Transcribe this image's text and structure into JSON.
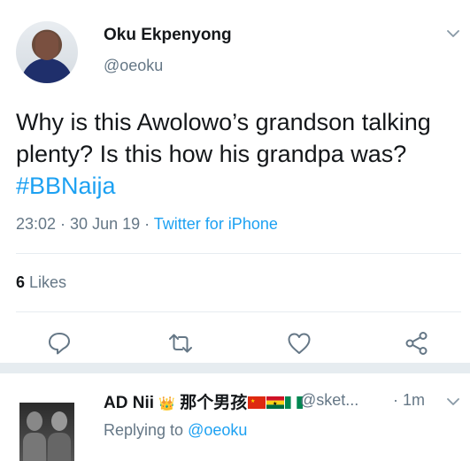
{
  "tweet": {
    "author_name": "Oku Ekpenyong",
    "author_handle": "@oeoku",
    "text_main": "Why is this Awolowo’s grandson talking plenty? Is this how his grandpa was? ",
    "hashtag": "#BBNaija",
    "time": "23:02",
    "dot1": " · ",
    "date": "30 Jun 19",
    "dot2": " · ",
    "source": "Twitter for iPhone",
    "likes_count": "6",
    "likes_label": " Likes"
  },
  "actions": {
    "icons": [
      "reply-icon",
      "retweet-icon",
      "like-icon",
      "share-icon"
    ]
  },
  "reply": {
    "author_name": "AD Nii",
    "crown": "👑",
    "name_chinese": " 那个男孩",
    "handle": "@sket...",
    "time": "· 1m",
    "replying_prefix": "Replying to ",
    "replying_to": "@oeoku"
  },
  "colors": {
    "accent": "#1da1f2",
    "muted": "#657786",
    "text": "#14171a",
    "divider": "#e6ecf0"
  }
}
